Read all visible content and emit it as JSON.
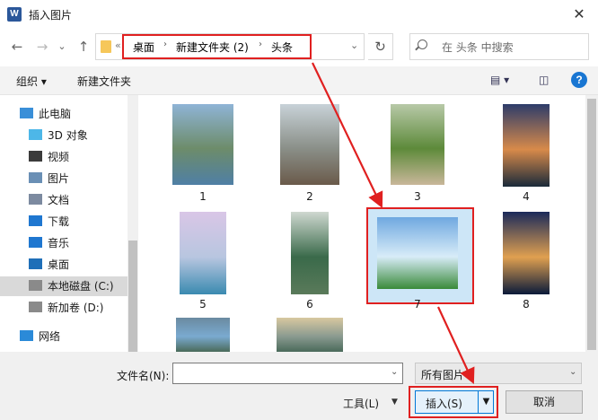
{
  "window": {
    "title": "插入图片",
    "app_icon": "word-icon",
    "close_glyph": "✕"
  },
  "nav": {
    "back_glyph": "←",
    "forward_glyph": "→",
    "dropdown_glyph": "⌄",
    "up_glyph": "↑",
    "address": {
      "prev_glyph": "«",
      "crumbs": [
        "桌面",
        "新建文件夹 (2)",
        "头条"
      ],
      "sep": "›"
    },
    "refresh_glyph": "↻",
    "search_placeholder": "在 头条 中搜索"
  },
  "toolbar": {
    "organize": "组织 ▾",
    "new_folder": "新建文件夹",
    "view_glyph": "▤ ▾",
    "pane_glyph": "◫",
    "help": "?"
  },
  "sidebar": {
    "items": [
      {
        "label": "此电脑",
        "icon": "computer-icon",
        "color": "#3a8fd8"
      },
      {
        "label": "3D 对象",
        "icon": "cube-icon",
        "color": "#4db7e8"
      },
      {
        "label": "视频",
        "icon": "video-icon",
        "color": "#3b3b3b"
      },
      {
        "label": "图片",
        "icon": "picture-icon",
        "color": "#6a8fb5"
      },
      {
        "label": "文档",
        "icon": "document-icon",
        "color": "#7c8aa0"
      },
      {
        "label": "下载",
        "icon": "download-icon",
        "color": "#1f77d0"
      },
      {
        "label": "音乐",
        "icon": "music-icon",
        "color": "#1f77d0"
      },
      {
        "label": "桌面",
        "icon": "desktop-icon",
        "color": "#1f6fb8"
      },
      {
        "label": "本地磁盘 (C:)",
        "icon": "drive-icon",
        "color": "#8a8a8a",
        "selected": true
      },
      {
        "label": "新加卷 (D:)",
        "icon": "drive-icon",
        "color": "#8a8a8a"
      },
      {
        "label": "网络",
        "icon": "network-icon",
        "color": "#2b8ad8"
      }
    ]
  },
  "files": [
    {
      "label": "1",
      "colors": [
        "#8fb4d6",
        "#6d8c6a",
        "#4f7fa5"
      ]
    },
    {
      "label": "2",
      "colors": [
        "#c8d2d8",
        "#8a8f88",
        "#6a5a4a"
      ]
    },
    {
      "label": "3",
      "colors": [
        "#b8c9a8",
        "#5d8a3a",
        "#c9b79a"
      ]
    },
    {
      "label": "4",
      "colors": [
        "#2d3c6a",
        "#d88a4a",
        "#1a2a3a"
      ]
    },
    {
      "label": "5",
      "colors": [
        "#d9c6e6",
        "#b8c6e0",
        "#3a8ab0"
      ]
    },
    {
      "label": "6",
      "colors": [
        "#cfd8d0",
        "#3a6a4a",
        "#5a7a5a"
      ]
    },
    {
      "label": "7",
      "colors": [
        "#6fa8e0",
        "#d8ecf8",
        "#3a8a3a"
      ]
    },
    {
      "label": "8",
      "colors": [
        "#1a2a5a",
        "#e0a050",
        "#0a1a3a"
      ]
    },
    {
      "label": "",
      "colors": [
        "#6a8aa0",
        "#7aaad0",
        "#4a6a5a"
      ]
    },
    {
      "label": "",
      "colors": [
        "#d8c8a0",
        "#8a9a90",
        "#4a6a5a"
      ]
    }
  ],
  "bottom": {
    "filename_label": "文件名(N):",
    "filename_value": "",
    "filetype": "所有图片",
    "tools": "工具(L)",
    "insert": "插入(S)",
    "cancel": "取消",
    "dd_glyph": "▼",
    "chev_glyph": "⌄"
  },
  "colors": {
    "accent": "#0078d7",
    "highlight_red": "#e02020",
    "selection": "#cde6f7"
  }
}
